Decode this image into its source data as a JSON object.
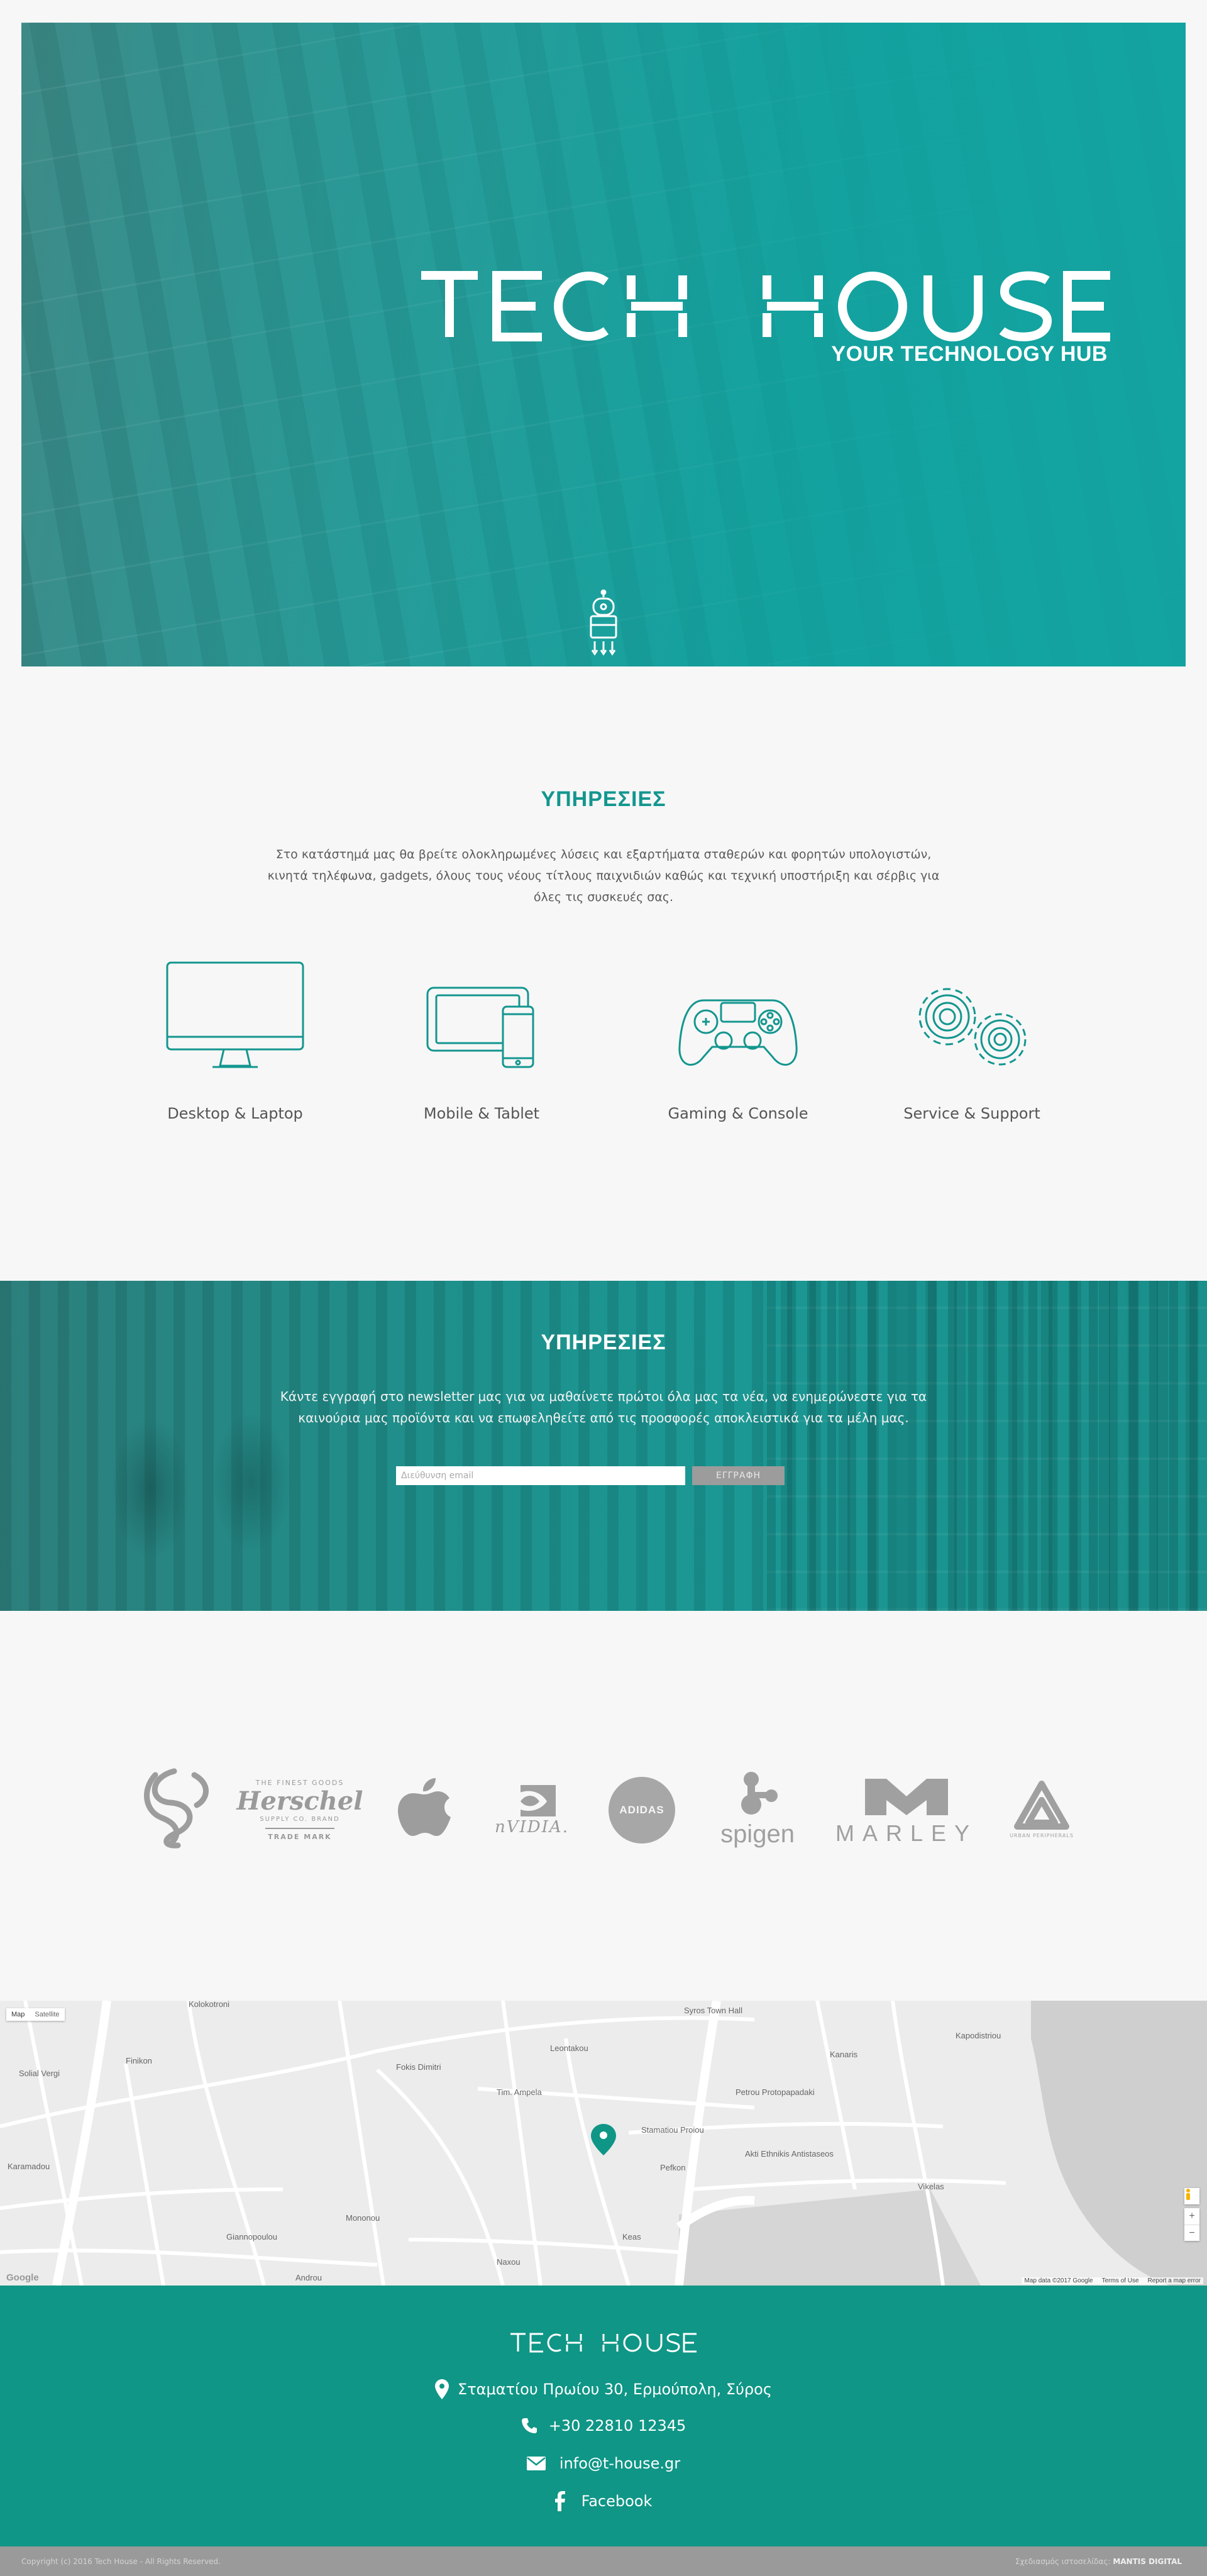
{
  "hero": {
    "brand": "TECH HOUSE",
    "tagline": "YOUR TECHNOLOGY HUB",
    "robot_icon": "robot-mascot-icon"
  },
  "services": {
    "title": "ΥΠΗΡΕΣΙΕΣ",
    "text": "Στο κατάστημά μας θα βρείτε ολοκληρωμένες λύσεις και εξαρτήματα σταθερών και φορητών υπολογιστών, κινητά τηλέφωνα, gadgets, όλους τους νέους τίτλους παιχνιδιών καθώς και τεχνική υποστήριξη και σέρβις για όλες τις συσκευές σας.",
    "items": [
      {
        "label": "Desktop & Laptop",
        "icon": "monitor-icon"
      },
      {
        "label": "Mobile & Tablet",
        "icon": "tablet-phone-icon"
      },
      {
        "label": "Gaming & Console",
        "icon": "gamepad-icon"
      },
      {
        "label": "Service & Support",
        "icon": "gears-icon"
      }
    ],
    "accent": "#13968f"
  },
  "newsletter": {
    "title": "ΥΠΗΡΕΣΙΕΣ",
    "text": "Κάντε εγγραφή στο newsletter μας για να μαθαίνετε πρώτοι όλα μας τα νέα, να ενημερώνεστε για τα καινούρια μας προϊόντα και να επωφεληθείτε από τις προσφορές αποκλειστικά για τα μέλη μας.",
    "placeholder": "Διεύθυνση email",
    "button": "ΕΓΓΡΑΦΗ"
  },
  "brands": {
    "herschel_top": "THE FINEST GOODS",
    "herschel_name": "Herschel",
    "herschel_sub": "SUPPLY CO. BRAND",
    "herschel_mark": "TRADE MARK",
    "nvidia": "nVIDIA.",
    "adidas": "ADIDAS",
    "spigen": "spigen",
    "marley": "MARLEY",
    "skullcandy_sub": "URBAN PERIPHERALS"
  },
  "map": {
    "map_button": "Map",
    "satellite_button": "Satellite",
    "data_credit": "Map data ©2017 Google",
    "terms": "Terms of Use",
    "report": "Report a map error",
    "google": "Google",
    "zoom_in": "+",
    "zoom_out": "−",
    "labels": [
      "Kolokotroni",
      "Solial Vergi",
      "Finikon",
      "Karamadou",
      "Fokis Dimitri",
      "Leontakou",
      "Syros Town Hall",
      "Tim. Ampela",
      "Stamatiou Proiou",
      "Petrou Protopapadaki",
      "Akti Ethnikis Antistaseos",
      "Kanaris",
      "Vikelas",
      "Kapodistriou",
      "Mononou",
      "Giannopoulou",
      "Pefkon",
      "Naxou",
      "Keas",
      "Androu"
    ]
  },
  "footer": {
    "brand": "TECH HOUSE",
    "address": "Σταματίου Πρωίου 30, Ερμούπολη, Σύρος",
    "phone": "+30 22810 12345",
    "email": "info@t-house.gr",
    "facebook": "Facebook",
    "copyright": "Copyright (c) 2016 Tech House - All Rights Reserved.",
    "credit_prefix": "Σχεδιασμός ιστοσελίδας:",
    "credit_name": "MANTIS DIGITAL",
    "color": "#0f9686"
  }
}
